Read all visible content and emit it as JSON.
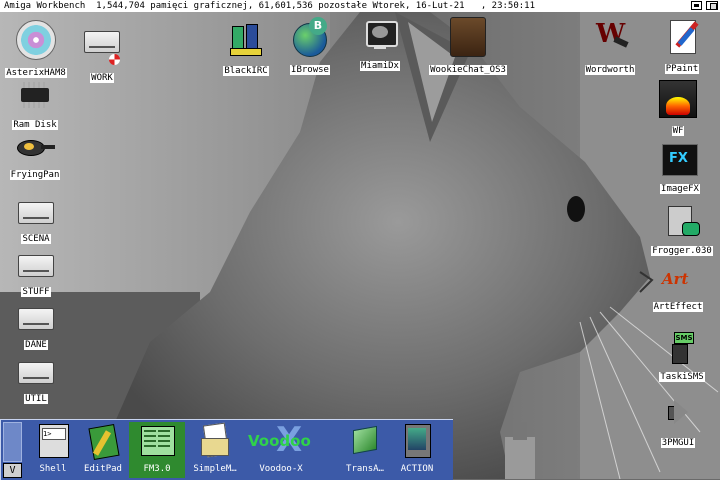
{
  "titlebar": {
    "text": "Amiga Workbench  1,544,704 pamięci graficznej, 61,601,536 pozostałe Wtorek, 16-Lut-21   , 23:50:11"
  },
  "desktop_icons": {
    "asterix": "AsterixHAM8",
    "work": "WORK",
    "blackirc": "BlackIRC",
    "ibrowse": "IBrowse",
    "miamidx": "MiamiDx",
    "wookiechat": "WookieChat_OS3",
    "wordworth": "Wordworth",
    "ppaint": "PPaint",
    "ramdisk": "Ram Disk",
    "fryingpan": "FryingPan",
    "wf": "WF",
    "imagefx": "ImageFX",
    "scena": "SCENA",
    "frogger": "Frogger.030",
    "stuff": "STUFF",
    "arteffect": "ArtEffect",
    "dane": "DANE",
    "taskisms": "TaskiSMS",
    "util": "UTIL",
    "mpgui": "3PMGUI"
  },
  "dock": {
    "toggle_label": "V",
    "items": [
      "Shell",
      "EditPad",
      "FM3.0",
      "SimpleM…",
      "Voodoo-X",
      "TransA…",
      "ACTION"
    ],
    "voodoo_logo": "Voodoo"
  },
  "colors": {
    "dock_bg": "#3c5aa8",
    "titlebar_bg": "#ffffff"
  }
}
